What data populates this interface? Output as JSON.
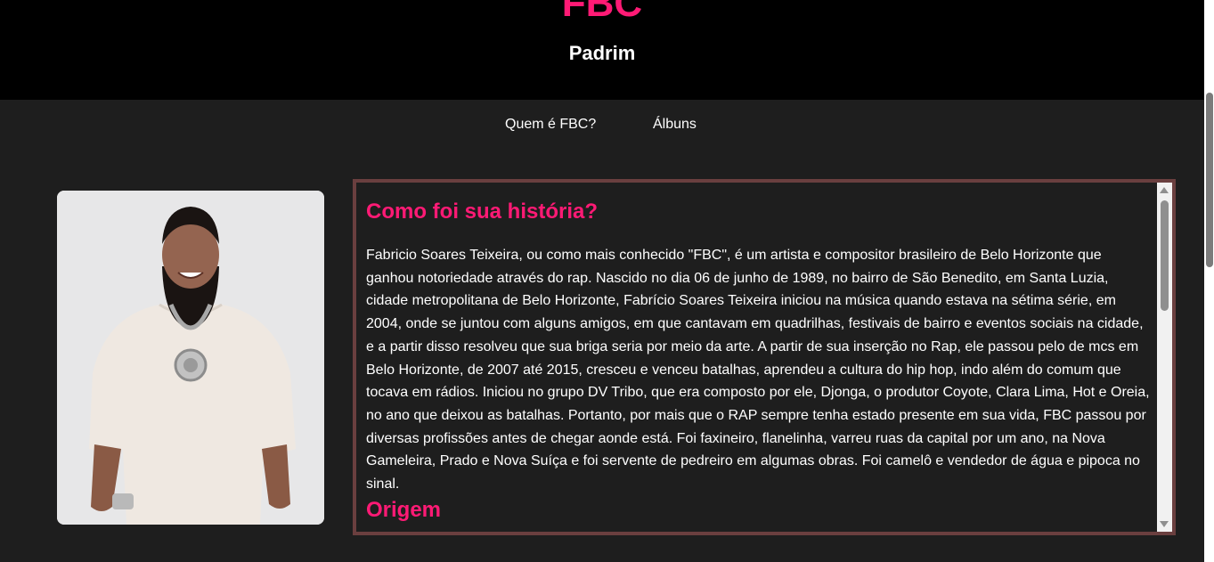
{
  "header": {
    "brand": "FBC",
    "subtitle": "Padrim"
  },
  "nav": {
    "items": [
      {
        "label": "Quem é FBC?"
      },
      {
        "label": "Álbuns"
      }
    ]
  },
  "colors": {
    "accent": "#ff1a75",
    "header_bg": "#000000",
    "page_bg": "#1e1e1e",
    "box_border": "#6a3f3f"
  },
  "main": {
    "photo_alt": "FBC",
    "story": {
      "title": "Como foi sua história?",
      "text": "Fabricio Soares Teixeira, ou como mais conhecido \"FBC\", é um artista e compositor brasileiro de Belo Horizonte que ganhou notoriedade através do rap. Nascido no dia 06 de junho de 1989, no bairro de São Benedito, em Santa Luzia, cidade metropolitana de Belo Horizonte, Fabrício Soares Teixeira iniciou na música quando estava na sétima série, em 2004, onde se juntou com alguns amigos, em que cantavam em quadrilhas, festivais de bairro e eventos sociais na cidade, e a partir disso resolveu que sua briga seria por meio da arte. A partir de sua inserção no Rap, ele passou pelo de mcs em Belo Horizonte, de 2007 até 2015, cresceu e venceu batalhas, aprendeu a cultura do hip hop, indo além do comum que tocava em rádios. Iniciou no grupo DV Tribo, que era composto por ele, Djonga, o produtor Coyote, Clara Lima, Hot e Oreia, no ano que deixou as batalhas. Portanto, por mais que o RAP sempre tenha estado presente em sua vida, FBC passou por diversas profissões antes de chegar aonde está. Foi faxineiro, flanelinha, varreu ruas da capital por um ano, na Nova Gameleira, Prado e Nova Suíça e foi servente de pedreiro em algumas obras. Foi camelô e vendedor de água e pipoca no sinal.",
      "next_title": "Origem"
    }
  }
}
